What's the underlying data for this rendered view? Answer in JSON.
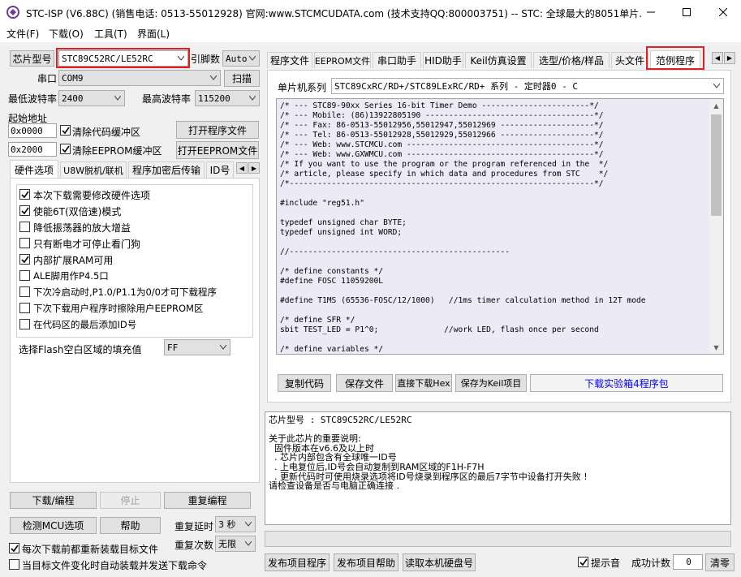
{
  "window": {
    "title": "STC-ISP (V6.88C) (销售电话: 0513-55012928) 官网:www.STCMCUDATA.com  (技术支持QQ:800003751) -- STC: 全球最大的8051单片..."
  },
  "menu": [
    "文件(F)",
    "下载(O)",
    "工具(T)",
    "界面(L)"
  ],
  "left": {
    "chip_type_btn": "芯片型号",
    "chip_type_value": "STC89C52RC/LE52RC",
    "pin_count_label": "引脚数",
    "pin_count_value": "Auto",
    "serial_label": "串口",
    "serial_value": "COM9",
    "scan_btn": "扫描",
    "min_baud_label": "最低波特率",
    "min_baud_value": "2400",
    "max_baud_label": "最高波特率",
    "max_baud_value": "115200",
    "start_addr_label": "起始地址",
    "addr1": "0x0000",
    "clear_code_label": "清除代码缓冲区",
    "open_prog_btn": "打开程序文件",
    "addr2": "0x2000",
    "clear_eeprom_label": "清除EEPROM缓冲区",
    "open_eeprom_btn": "打开EEPROM文件",
    "tabs": [
      "硬件选项",
      "U8W脱机/联机",
      "程序加密后传输",
      "ID号"
    ],
    "options": [
      {
        "label": "本次下载需要修改硬件选项",
        "checked": true
      },
      {
        "label": "使能6T(双倍速)模式",
        "checked": true
      },
      {
        "label": "降低振荡器的放大增益",
        "checked": false
      },
      {
        "label": "只有断电才可停止看门狗",
        "checked": false
      },
      {
        "label": "内部扩展RAM可用",
        "checked": true
      },
      {
        "label": "ALE脚用作P4.5口",
        "checked": false
      },
      {
        "label": "下次冷启动时,P1.0/P1.1为0/0才可下载程序",
        "checked": false
      },
      {
        "label": "下次下载用户程序时擦除用户EEPROM区",
        "checked": false
      },
      {
        "label": "在代码区的最后添加ID号",
        "checked": false
      }
    ],
    "fill_label": "选择Flash空白区域的填充值",
    "fill_value": "FF",
    "download_btn": "下载/编程",
    "stop_btn": "停止",
    "reprogram_btn": "重复编程",
    "detect_btn": "检测MCU选项",
    "help_btn": "帮助",
    "repeat_delay_label": "重复延时",
    "repeat_delay_value": "3 秒",
    "repeat_count_label": "重复次数",
    "repeat_count_value": "无限",
    "reload_label": "每次下载前都重新装载目标文件",
    "auto_send_label": "当目标文件变化时自动装载并发送下载命令"
  },
  "right": {
    "tabs": [
      "程序文件",
      "EEPROM文件",
      "串口助手",
      "HID助手",
      "Keil仿真设置",
      "选型/价格/样品",
      "头文件",
      "范例程序"
    ],
    "series_label": "单片机系列",
    "series_value": "STC89CxRC/RD+/STC89LExRC/RD+ 系列 - 定时器0 - C",
    "code_lines": [
      "/* --- STC89-90xx Series 16-bit Timer Demo -----------------------*/",
      "/* --- Mobile: (86)13922805190 ------------------------------------*/",
      "/* --- Fax: 86-0513-55012956,55012947,55012969 --------------------*/",
      "/* --- Tel: 86-0513-55012928,55012929,55012966 --------------------*/",
      "/* --- Web: www.STCMCU.com ----------------------------------------*/",
      "/* --- Web: www.GXWMCU.com ----------------------------------------*/",
      "/* If you want to use the program or the program referenced in the  */",
      "/* article, please specify in which data and procedures from STC    */",
      "/*-----------------------------------------------------------------*/",
      "",
      "#include \"reg51.h\"",
      "",
      "typedef unsigned char BYTE;",
      "typedef unsigned int WORD;",
      "",
      "//-----------------------------------------------",
      "",
      "/* define constants */",
      "#define FOSC 11059200L",
      "",
      "#define T1MS (65536-FOSC/12/1000)   //1ms timer calculation method in 12T mode",
      "",
      "/* define SFR */",
      "sbit TEST_LED = P1^0;              //work LED, flash once per second",
      "",
      "/* define variables */"
    ],
    "copy_btn": "复制代码",
    "save_btn": "保存文件",
    "direct_dl_btn": "直接下载Hex",
    "save_keil_btn": "保存为Keil项目",
    "dl_pkg_link": "下载实验箱4程序包",
    "info_lines": [
      "芯片型号 : STC89C52RC/LE52RC",
      "",
      "关于此芯片的重要说明:",
      "  固件版本在v6.6及以上时",
      "  . 芯片内部包含有全球唯一ID号",
      "  . 上电复位后,ID号会自动复制到RAM区域的F1H-F7H",
      "  . 更新代码时可使用烧录选项将ID号烧录到程序区的最后7字节中设备打开失败 !",
      "请检查设备是否与电脑正确连接 ."
    ],
    "publish_btn": "发布项目程序",
    "publish_help_btn": "发布项目帮助",
    "read_disk_btn": "读取本机硬盘号",
    "beep_label": "提示音",
    "success_label": "成功计数",
    "success_value": "0",
    "clear_btn": "清零"
  },
  "colors": {
    "accent": "#0078d7",
    "highlight_box": "#e02020",
    "editor_bg": "#ebeaf5",
    "link": "#0000ff"
  }
}
